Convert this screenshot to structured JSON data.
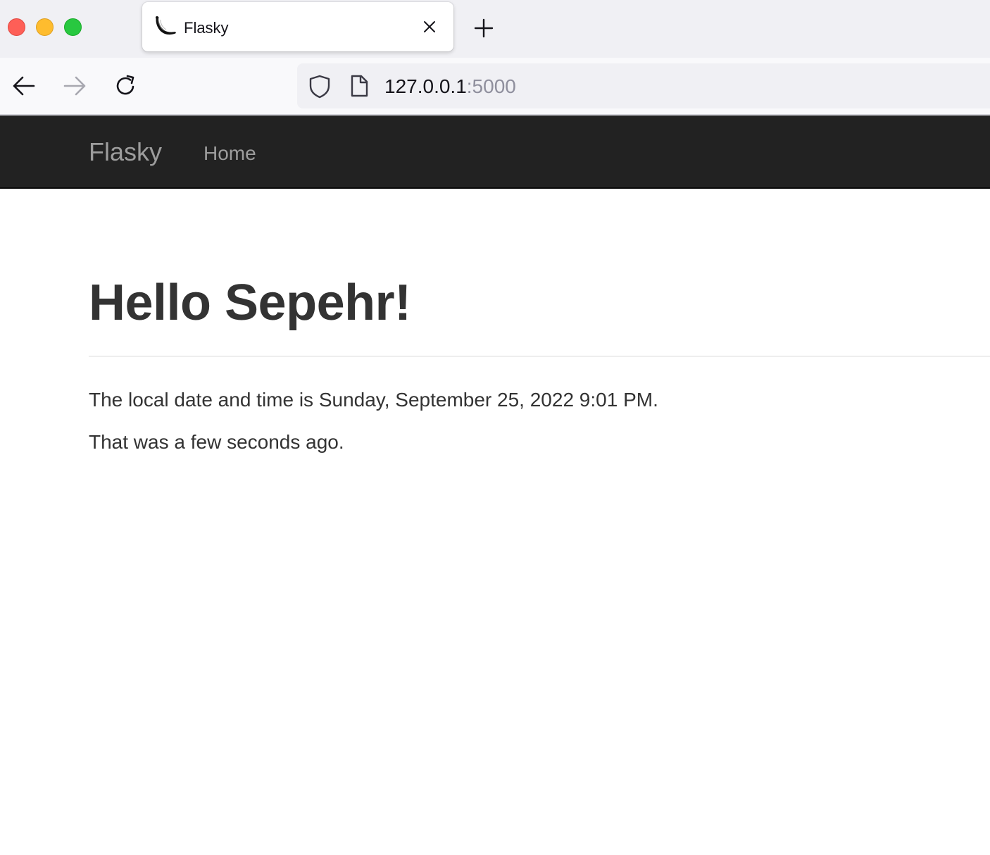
{
  "browser": {
    "window_controls": [
      "close",
      "minimize",
      "maximize"
    ],
    "tab": {
      "title": "Flasky",
      "favicon": "flask-horn-icon"
    },
    "url": {
      "host": "127.0.0.1",
      "port": ":5000"
    }
  },
  "site": {
    "brand": "Flasky",
    "nav_items": [
      {
        "label": "Home"
      }
    ]
  },
  "main": {
    "heading": "Hello Sepehr!",
    "local_time_text": "The local date and time is Sunday, September 25, 2022 9:01 PM.",
    "relative_time_text": "That was a few seconds ago."
  },
  "colors": {
    "navbar_bg": "#222222",
    "nav_text": "#9d9d9d",
    "body_text": "#333333",
    "close": "#fe5f57",
    "minimize": "#febc2e",
    "maximize": "#28c840"
  }
}
